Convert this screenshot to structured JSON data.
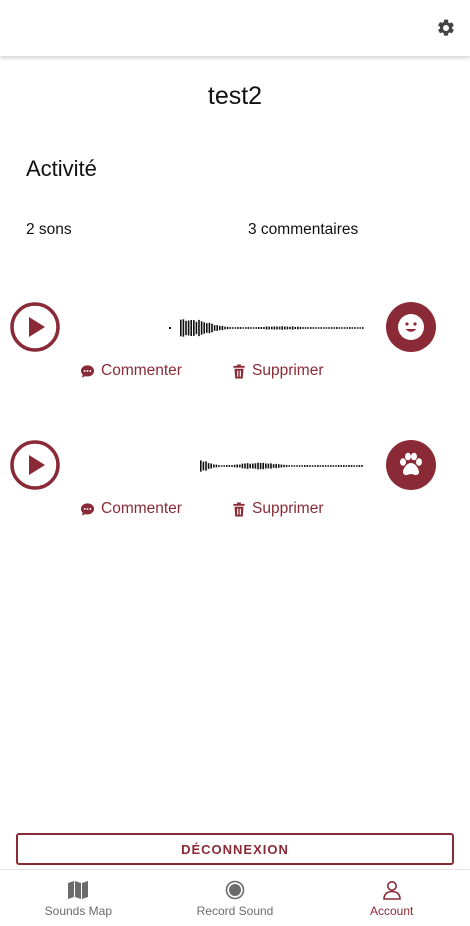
{
  "profile": {
    "username": "test2",
    "section_title": "Activité",
    "sounds_count_label": "2 sons",
    "comments_count_label": "3 commentaires"
  },
  "sounds": [
    {
      "comment_label": "Commenter",
      "delete_label": "Supprimer",
      "avatar_icon": "smiley-icon"
    },
    {
      "comment_label": "Commenter",
      "delete_label": "Supprimer",
      "avatar_icon": "paw-icon"
    }
  ],
  "logout_label": "DÉCONNEXION",
  "nav": {
    "items": [
      {
        "label": "Sounds Map",
        "icon": "map-icon",
        "active": false
      },
      {
        "label": "Record Sound",
        "icon": "record-icon",
        "active": false
      },
      {
        "label": "Account",
        "icon": "user-icon",
        "active": true
      }
    ]
  },
  "colors": {
    "accent": "#8a2a36",
    "nav_inactive": "#6b6b6b"
  }
}
